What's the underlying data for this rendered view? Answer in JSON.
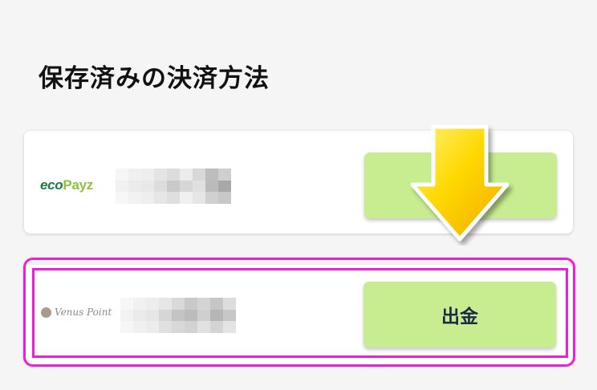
{
  "page": {
    "title": "保存済みの決済方法"
  },
  "methods": [
    {
      "logo": {
        "part1": "eco",
        "part2": "Payz",
        "icon": "ecopayz-logo"
      },
      "masked_id_colors": [
        "#f6f6f6",
        "#f0f0f0",
        "#eeeeee",
        "#e4e4e4",
        "#dcdcdc",
        "#ececec",
        "#d8d8d8",
        "#bdbdbd",
        "#cfcfcf",
        "#f1f1f1",
        "#ebebeb",
        "#e8e8e8",
        "#dddddd",
        "#c9c9c9",
        "#d6d6d6",
        "#e0e0e0",
        "#bbbbbb",
        "#a8a8a8",
        "#f7f7f7",
        "#f2f2f2",
        "#eeeeee",
        "#e6e6e6",
        "#dfdfdf",
        "#f0f0f0",
        "#e6e6e6",
        "#d0d0d0",
        "#c8c8c8"
      ],
      "button_label": ""
    },
    {
      "logo": {
        "text": "Venus Point",
        "icon": "venus-point-logo"
      },
      "masked_id_colors": [
        "#f7f7f7",
        "#f1f1f1",
        "#ededed",
        "#e6e6e6",
        "#d9d9d9",
        "#c9c9c9",
        "#d4d4d4",
        "#c6c6c6",
        "#dddddd",
        "#f2f2f2",
        "#ebebeb",
        "#e6e6e6",
        "#d6d6d6",
        "#c4c4c4",
        "#bcbcbc",
        "#cfcfcf",
        "#b6b6b6",
        "#c7c7c7",
        "#f6f6f6",
        "#f0f0f0",
        "#ececec",
        "#e0e0e0",
        "#d8d8d8",
        "#d2d2d2",
        "#e1e1e1",
        "#d4d4d4",
        "#e4e4e4"
      ],
      "button_label": "出金"
    }
  ],
  "annotations": {
    "arrow": "down-arrow-icon",
    "highlight": "highlight-frame",
    "highlight_color": "#ee1fdc",
    "arrow_color": "#ffd800"
  },
  "colors": {
    "background": "#f5f5f5",
    "card": "#ffffff",
    "button": "#c8ec90",
    "button_text": "#1b2a44"
  }
}
